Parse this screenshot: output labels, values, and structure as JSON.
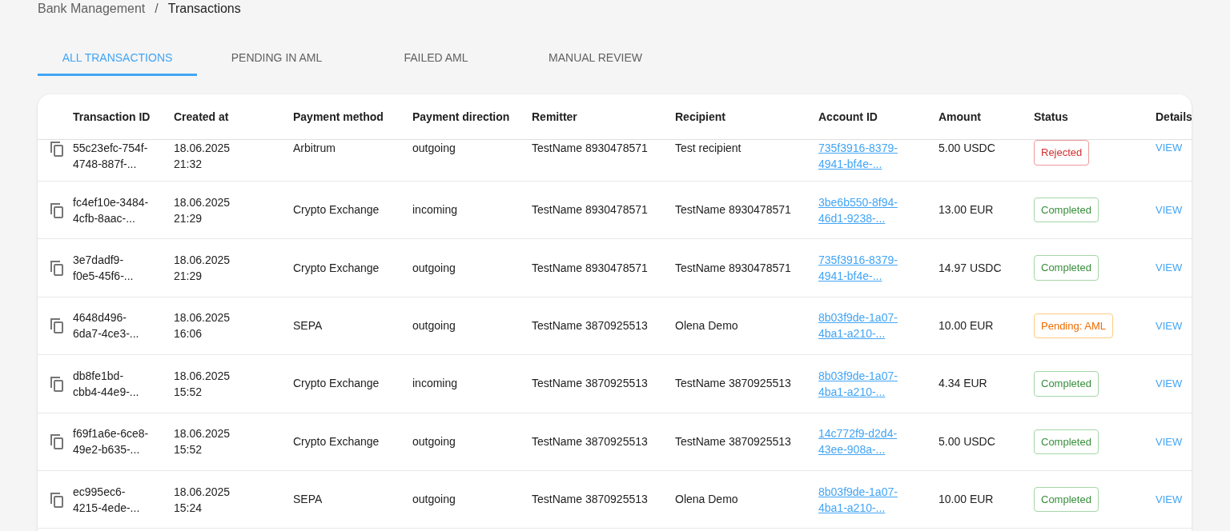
{
  "breadcrumb": {
    "parent": "Bank Management",
    "separator": "/",
    "current": "Transactions"
  },
  "tabs": [
    {
      "label": "ALL TRANSACTIONS",
      "selected": true
    },
    {
      "label": "PENDING IN AML",
      "selected": false
    },
    {
      "label": "FAILED AML",
      "selected": false
    },
    {
      "label": "MANUAL REVIEW",
      "selected": false
    }
  ],
  "table": {
    "columns": [
      "Transaction ID",
      "Created at",
      "Payment method",
      "Payment direction",
      "Remitter",
      "Recipient",
      "Account ID",
      "Amount",
      "Status",
      "Details"
    ],
    "rows": [
      {
        "transaction_id": [
          "55c23efc-754f-",
          "4748-887f-..."
        ],
        "created_at": [
          "18.06.2025",
          "21:32"
        ],
        "payment_method": "Arbitrum",
        "payment_direction": "outgoing",
        "remitter": "TestName 8930478571",
        "recipient": "Test recipient",
        "account_id": [
          "735f3916-8379-",
          "4941-bf4e-..."
        ],
        "amount": "5.00 USDC",
        "status": {
          "label": "Rejected",
          "kind": "rejected"
        },
        "details": "VIEW"
      },
      {
        "transaction_id": [
          "fc4ef10e-3484-",
          "4cfb-8aac-..."
        ],
        "created_at": [
          "18.06.2025",
          "21:29"
        ],
        "payment_method": "Crypto Exchange",
        "payment_direction": "incoming",
        "remitter": "TestName 8930478571",
        "recipient": "TestName 8930478571",
        "account_id": [
          "3be6b550-8f94-",
          "46d1-9238-..."
        ],
        "amount": "13.00 EUR",
        "status": {
          "label": "Completed",
          "kind": "completed"
        },
        "details": "VIEW"
      },
      {
        "transaction_id": [
          "3e7dadf9-",
          "f0e5-45f6-..."
        ],
        "created_at": [
          "18.06.2025",
          "21:29"
        ],
        "payment_method": "Crypto Exchange",
        "payment_direction": "outgoing",
        "remitter": "TestName 8930478571",
        "recipient": "TestName 8930478571",
        "account_id": [
          "735f3916-8379-",
          "4941-bf4e-..."
        ],
        "amount": "14.97 USDC",
        "status": {
          "label": "Completed",
          "kind": "completed"
        },
        "details": "VIEW"
      },
      {
        "transaction_id": [
          "4648d496-",
          "6da7-4ce3-..."
        ],
        "created_at": [
          "18.06.2025",
          "16:06"
        ],
        "payment_method": "SEPA",
        "payment_direction": "outgoing",
        "remitter": "TestName 3870925513",
        "recipient": "Olena Demo",
        "account_id": [
          "8b03f9de-1a07-",
          "4ba1-a210-..."
        ],
        "amount": "10.00 EUR",
        "status": {
          "label": "Pending: AML",
          "kind": "pending"
        },
        "details": "VIEW"
      },
      {
        "transaction_id": [
          "db8fe1bd-",
          "cbb4-44e9-..."
        ],
        "created_at": [
          "18.06.2025",
          "15:52"
        ],
        "payment_method": "Crypto Exchange",
        "payment_direction": "incoming",
        "remitter": "TestName 3870925513",
        "recipient": "TestName 3870925513",
        "account_id": [
          "8b03f9de-1a07-",
          "4ba1-a210-..."
        ],
        "amount": "4.34 EUR",
        "status": {
          "label": "Completed",
          "kind": "completed"
        },
        "details": "VIEW"
      },
      {
        "transaction_id": [
          "f69f1a6e-6ce8-",
          "49e2-b635-..."
        ],
        "created_at": [
          "18.06.2025",
          "15:52"
        ],
        "payment_method": "Crypto Exchange",
        "payment_direction": "outgoing",
        "remitter": "TestName 3870925513",
        "recipient": "TestName 3870925513",
        "account_id": [
          "14c772f9-d2d4-",
          "43ee-908a-..."
        ],
        "amount": "5.00 USDC",
        "status": {
          "label": "Completed",
          "kind": "completed"
        },
        "details": "VIEW"
      },
      {
        "transaction_id": [
          "ec995ec6-",
          "4215-4ede-..."
        ],
        "created_at": [
          "18.06.2025",
          "15:24"
        ],
        "payment_method": "SEPA",
        "payment_direction": "outgoing",
        "remitter": "TestName 3870925513",
        "recipient": "Olena Demo",
        "account_id": [
          "8b03f9de-1a07-",
          "4ba1-a210-..."
        ],
        "amount": "10.00 EUR",
        "status": {
          "label": "Completed",
          "kind": "completed"
        },
        "details": "VIEW"
      }
    ]
  }
}
